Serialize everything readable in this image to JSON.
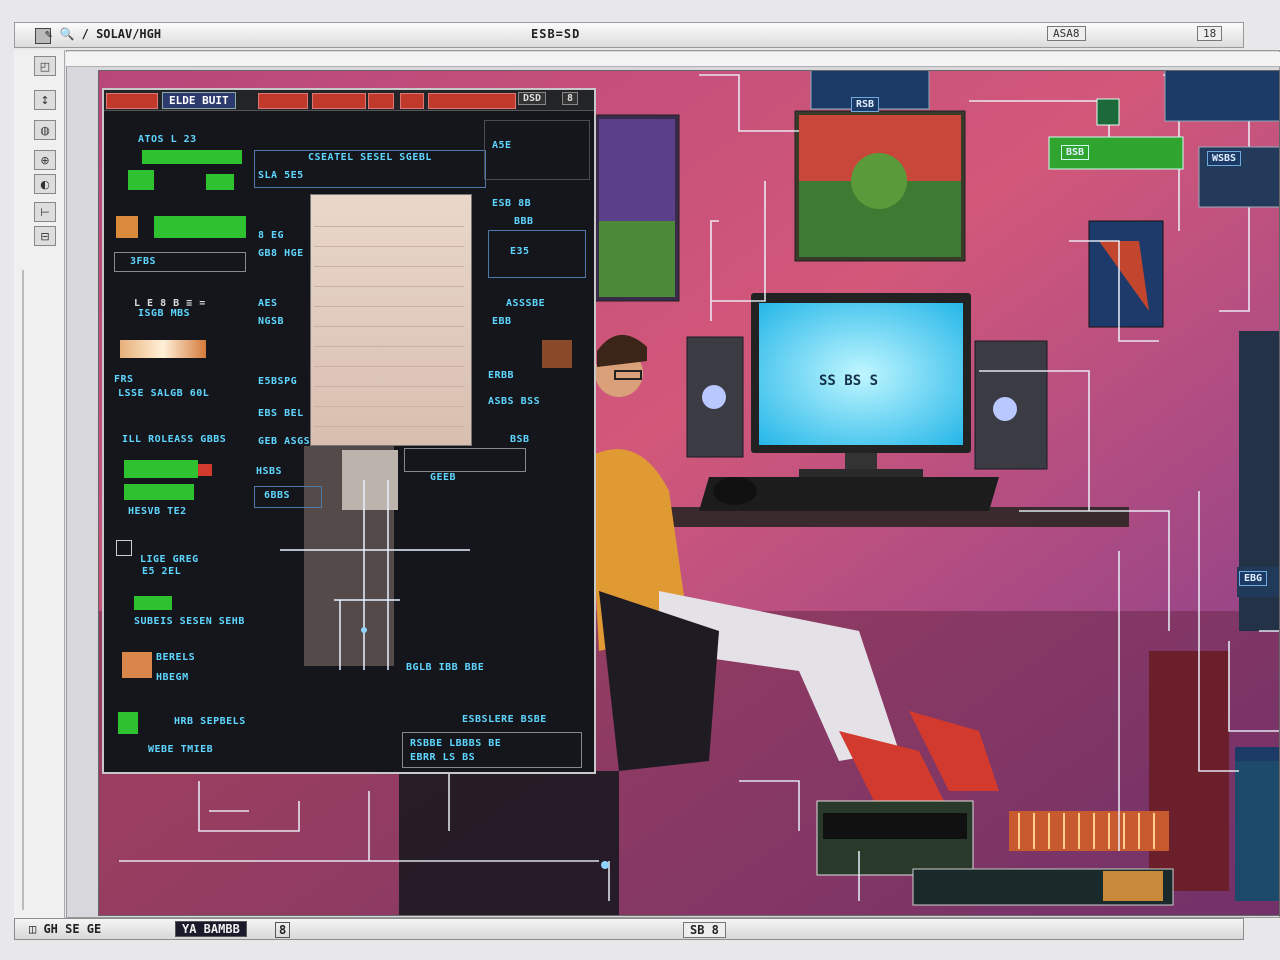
{
  "window": {
    "title": "✎ 🔍 / SOLAV/HGH",
    "center_title": "ESB=SD",
    "right_labels": [
      "ASA8",
      "18"
    ]
  },
  "toolbar": {
    "tools": [
      "◰",
      "↕",
      "◍",
      "⊕",
      "◐",
      "⊢",
      "⊟"
    ]
  },
  "panel": {
    "title": "ELDE BUIT",
    "header_buttons": [
      "DSD",
      "8"
    ],
    "left_labels": [
      "ATOS L 23",
      "3FBS",
      "L E 8 B  ≡ =",
      "ISGB MBS",
      "FRS",
      "LSSE SALGB 60L",
      "ILL ROLEASS GBBS",
      "HESVB TE2",
      "LIGE GREG",
      "E5 2EL",
      "SUBEIS SESEN SEHB",
      "BERELS",
      "HBEGM",
      "HRB SEPBELS",
      "WEBE TMIEB"
    ],
    "mid_labels": [
      "CSEATEL SESEL SGEBL",
      "SLA 5E5",
      "8 EG",
      "GB8 HGE",
      "AES",
      "NGSB",
      "E5BSPG",
      "EBS BEL",
      "GEB ASGS",
      "HSBS",
      "6BBS"
    ],
    "right_labels": [
      "A5E",
      "ESB 8B",
      "BBB",
      "E35",
      "ASSSBE",
      "EBB",
      "ERBB",
      "ASBS BSS",
      "BSB",
      "GEEB",
      "BGLB IBB BBE",
      "ESBSLERE BSBE",
      "RSBBE LBBBS BE",
      "EBRR LS BS"
    ]
  },
  "scene": {
    "screen_text": "SS BS S",
    "tags": [
      "RSB",
      "WSBS",
      "BSB",
      "EBG"
    ]
  },
  "statusbar": {
    "left": "◫ GH  SE  GE",
    "field": "YA BAMBB",
    "field2": "8",
    "center": "SB 8"
  },
  "colors": {
    "panel_bg": "#14161b",
    "label_cyan": "#5fd6ff",
    "accent_green": "#2fc12f",
    "accent_red": "#c0392b",
    "scene_pink": "#c94a6a"
  }
}
